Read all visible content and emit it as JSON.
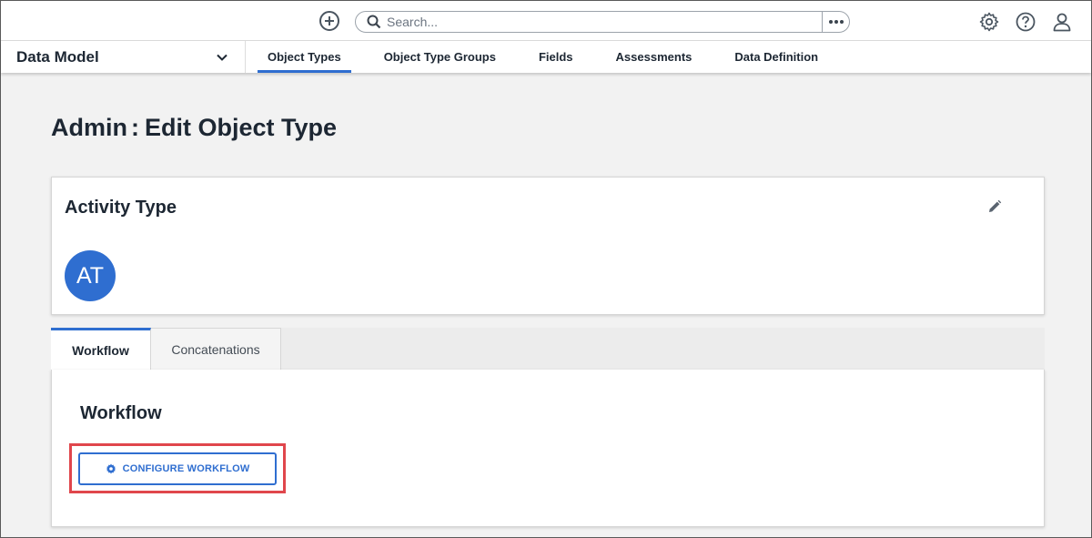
{
  "topbar": {
    "search_placeholder": "Search...",
    "icons": [
      "add-icon",
      "search-icon",
      "more-icon",
      "gear-icon",
      "help-icon",
      "user-icon"
    ]
  },
  "nav": {
    "section_title": "Data Model",
    "tabs": [
      {
        "label": "Object Types",
        "active": true
      },
      {
        "label": "Object Type Groups",
        "active": false
      },
      {
        "label": "Fields",
        "active": false
      },
      {
        "label": "Assessments",
        "active": false
      },
      {
        "label": "Data Definition",
        "active": false
      }
    ]
  },
  "page": {
    "title_prefix": "Admin",
    "title_separator": ":",
    "title_main": "Edit Object Type"
  },
  "object": {
    "name": "Activity Type",
    "avatar_initials": "AT"
  },
  "tabs": [
    {
      "label": "Workflow",
      "active": true
    },
    {
      "label": "Concatenations",
      "active": false
    }
  ],
  "workflow": {
    "heading": "Workflow",
    "button_label": "CONFIGURE WORKFLOW"
  },
  "colors": {
    "accent": "#2f6ed0",
    "highlight": "#e0464c",
    "text": "#1d2733"
  }
}
